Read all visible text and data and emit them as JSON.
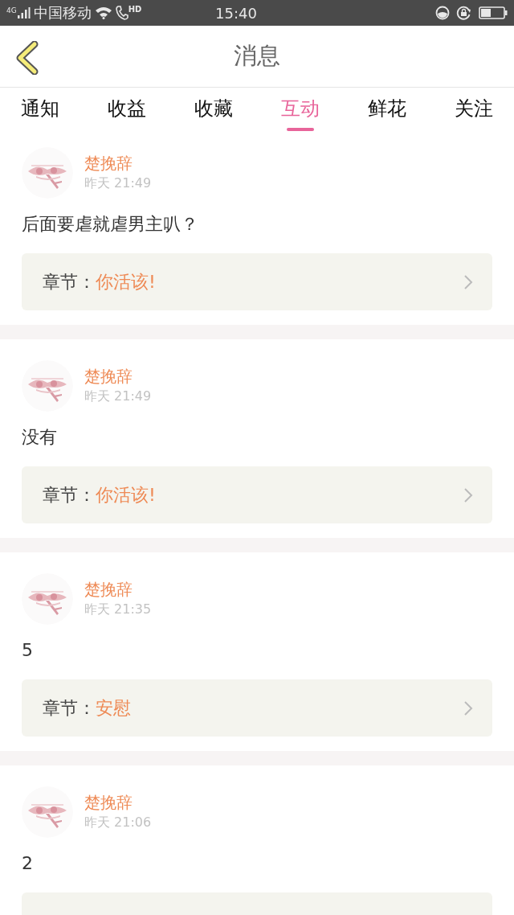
{
  "status_bar": {
    "network": "4G",
    "carrier": "中国移动",
    "call": "HD",
    "time": "15:40"
  },
  "header": {
    "title": "消息"
  },
  "tabs": [
    {
      "label": "通知",
      "selected": false
    },
    {
      "label": "收益",
      "selected": false
    },
    {
      "label": "收藏",
      "selected": false
    },
    {
      "label": "互动",
      "selected": true
    },
    {
      "label": "鲜花",
      "selected": false
    },
    {
      "label": "关注",
      "selected": false
    }
  ],
  "messages": [
    {
      "name": "楚挽辞",
      "time": "昨天 21:49",
      "text": "后面要虐就虐男主叭？",
      "chapter_label": "章节：",
      "chapter": "你活该!"
    },
    {
      "name": "楚挽辞",
      "time": "昨天 21:49",
      "text": "没有",
      "chapter_label": "章节：",
      "chapter": "你活该!"
    },
    {
      "name": "楚挽辞",
      "time": "昨天 21:35",
      "text": "5",
      "chapter_label": "章节：",
      "chapter": "安慰"
    },
    {
      "name": "楚挽辞",
      "time": "昨天 21:06",
      "text": "2"
    }
  ]
}
